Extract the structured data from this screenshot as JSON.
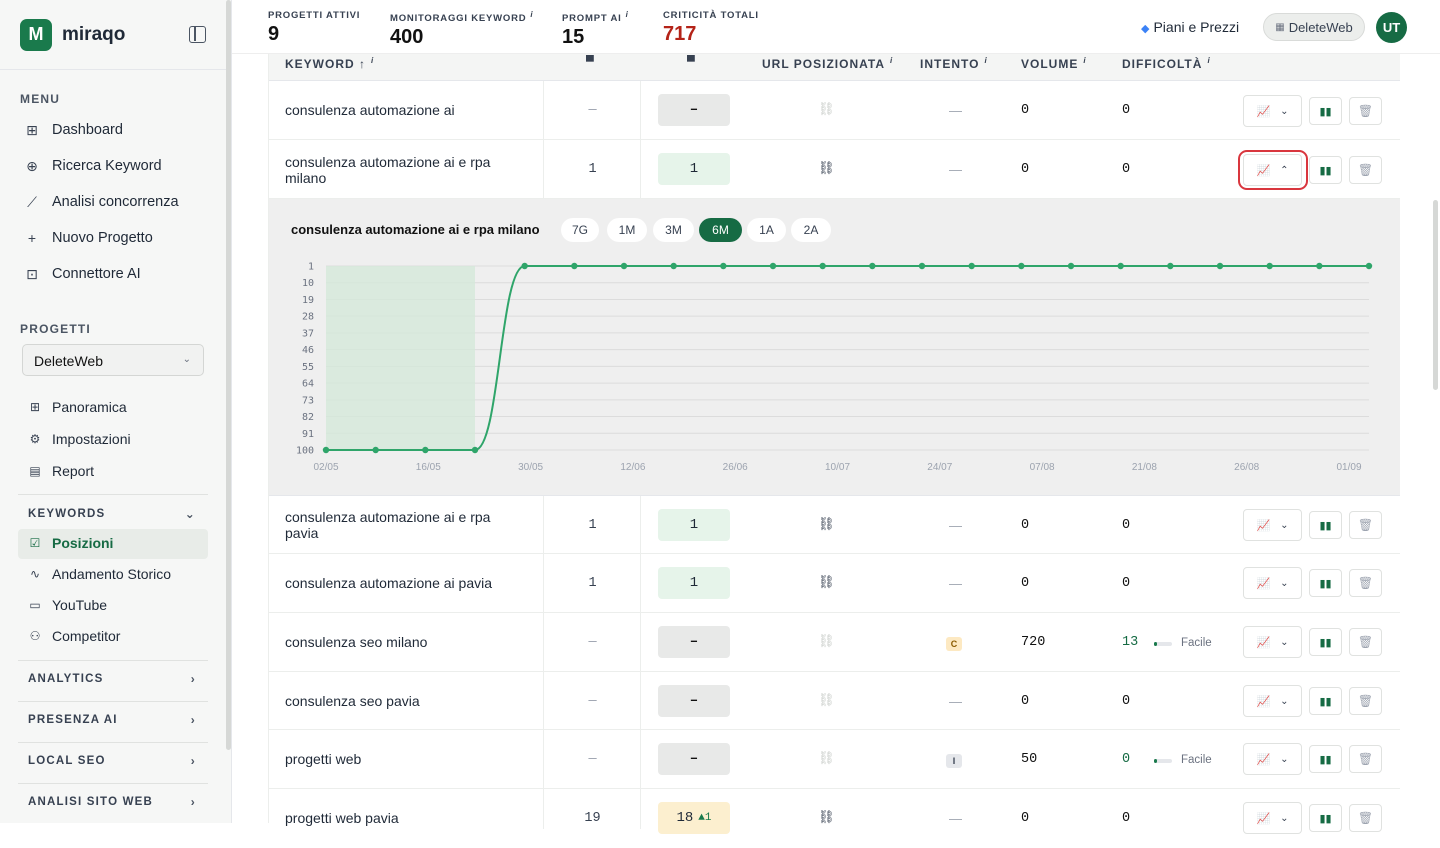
{
  "app": {
    "brand": "miraqo",
    "logo_letter": "M"
  },
  "sidebar": {
    "menu_label": "MENU",
    "menu_items": [
      {
        "label": "Dashboard",
        "icon": "grid-icon"
      },
      {
        "label": "Ricerca Keyword",
        "icon": "search-plus-icon"
      },
      {
        "label": "Analisi concorrenza",
        "icon": "line-chart-icon"
      },
      {
        "label": "Nuovo Progetto",
        "icon": "plus-icon"
      },
      {
        "label": "Connettore AI",
        "icon": "robot-icon"
      }
    ],
    "projects_label": "PROGETTI",
    "project_selected": "DeleteWeb",
    "project_items": [
      {
        "label": "Panoramica",
        "icon": "grid-small-icon"
      },
      {
        "label": "Impostazioni",
        "icon": "gear-icon"
      },
      {
        "label": "Report",
        "icon": "document-icon"
      }
    ],
    "keywords_group": "KEYWORDS",
    "keyword_items": [
      {
        "label": "Posizioni",
        "icon": "checkbox-chart-icon"
      },
      {
        "label": "Andamento Storico",
        "icon": "pulse-icon"
      },
      {
        "label": "YouTube",
        "icon": "youtube-icon"
      },
      {
        "label": "Competitor",
        "icon": "users-icon"
      }
    ],
    "groups": [
      "ANALYTICS",
      "PRESENZA AI",
      "LOCAL SEO",
      "ANALISI SITO WEB"
    ]
  },
  "topbar": {
    "stats": [
      {
        "label": "PROGETTI ATTIVI",
        "value": "9",
        "info": false
      },
      {
        "label": "MONITORAGGI KEYWORD",
        "value": "400",
        "info": true
      },
      {
        "label": "PROMPT AI",
        "value": "15",
        "info": true
      },
      {
        "label": "CRITICITÀ TOTALI",
        "value": "717",
        "info": false
      }
    ],
    "plans_label": "Piani e Prezzi",
    "project_button": "DeleteWeb",
    "avatar_initials": "UT"
  },
  "table": {
    "headers": {
      "keyword": "KEYWORD ↑",
      "url": "URL POSIZIONATA",
      "intent": "INTENTO",
      "volume": "VOLUME",
      "difficulty": "DIFFICOLTÀ"
    },
    "rows": [
      {
        "keyword": "consulenza automazione ai",
        "pos_prev": "—",
        "pos": "–",
        "pos_style": "gray",
        "url_active": false,
        "intent": "—",
        "volume": "0",
        "difficulty": "0"
      },
      {
        "keyword": "consulenza automazione ai e rpa milano",
        "pos_prev": "1",
        "pos": "1",
        "pos_style": "green",
        "url_active": true,
        "intent": "—",
        "volume": "0",
        "difficulty": "0",
        "expanded": true
      },
      {
        "keyword": "consulenza automazione ai e rpa pavia",
        "pos_prev": "1",
        "pos": "1",
        "pos_style": "green",
        "url_active": true,
        "intent": "—",
        "volume": "0",
        "difficulty": "0"
      },
      {
        "keyword": "consulenza automazione ai pavia",
        "pos_prev": "1",
        "pos": "1",
        "pos_style": "green",
        "url_active": true,
        "intent": "—",
        "volume": "0",
        "difficulty": "0"
      },
      {
        "keyword": "consulenza seo milano",
        "pos_prev": "—",
        "pos": "–",
        "pos_style": "gray",
        "url_active": false,
        "intent_badge": "C",
        "volume": "720",
        "difficulty": "13",
        "difficulty_label": "Facile"
      },
      {
        "keyword": "consulenza seo pavia",
        "pos_prev": "—",
        "pos": "–",
        "pos_style": "gray",
        "url_active": false,
        "intent": "—",
        "volume": "0",
        "difficulty": "0"
      },
      {
        "keyword": "progetti web",
        "pos_prev": "—",
        "pos": "–",
        "pos_style": "gray",
        "url_active": false,
        "intent_badge": "I",
        "volume": "50",
        "difficulty": "0",
        "difficulty_label": "Facile"
      },
      {
        "keyword": "progetti web pavia",
        "pos_prev": "19",
        "pos": "18",
        "pos_change": "▲1",
        "pos_style": "yellow",
        "url_active": true,
        "intent": "—",
        "volume": "0",
        "difficulty": "0"
      }
    ]
  },
  "expanded_panel": {
    "title": "consulenza automazione ai e rpa milano",
    "ranges": [
      "7G",
      "1M",
      "3M",
      "6M",
      "1A",
      "2A"
    ],
    "active_range": "6M"
  },
  "chart_data": {
    "type": "line",
    "title": "",
    "xlabel": "",
    "ylabel": "",
    "y_reversed": true,
    "ylim": [
      1,
      100
    ],
    "y_ticks": [
      1,
      10,
      19,
      28,
      37,
      46,
      55,
      64,
      73,
      82,
      91,
      100
    ],
    "x_ticks": [
      "02/05",
      "16/05",
      "30/05",
      "12/06",
      "26/06",
      "10/07",
      "24/07",
      "07/08",
      "21/08",
      "26/08",
      "01/09"
    ],
    "color": "#2fa56a",
    "series": [
      {
        "values": [
          100,
          100,
          100,
          100,
          1,
          1,
          1,
          1,
          1,
          1,
          1,
          1,
          1,
          1,
          1,
          1,
          1,
          1,
          1,
          1,
          1,
          1
        ]
      }
    ]
  }
}
